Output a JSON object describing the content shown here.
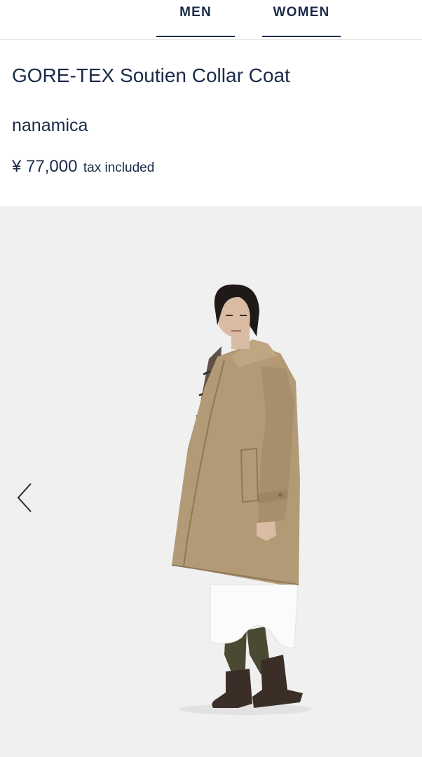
{
  "nav": {
    "tabs": [
      {
        "label": "MEN"
      },
      {
        "label": "WOMEN"
      }
    ]
  },
  "product": {
    "title": "GORE-TEX Soutien Collar Coat",
    "brand": "nanamica",
    "price": "¥ 77,000",
    "tax_note": "tax included"
  },
  "gallery": {
    "image_subject": "product-photo",
    "prev_icon": "chevron-left-icon"
  },
  "colors": {
    "text": "#1c2a4a",
    "gallery_bg": "#f0f0f0",
    "coat": "#b39a76"
  }
}
